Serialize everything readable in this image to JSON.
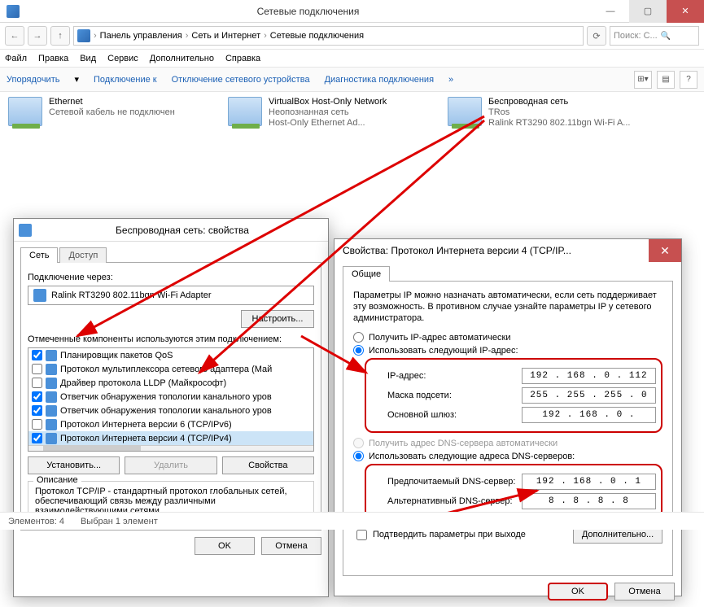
{
  "window": {
    "title": "Сетевые подключения",
    "breadcrumb": [
      "Панель управления",
      "Сеть и Интернет",
      "Сетевые подключения"
    ],
    "search_placeholder": "Поиск: С..."
  },
  "menu": [
    "Файл",
    "Правка",
    "Вид",
    "Сервис",
    "Дополнительно",
    "Справка"
  ],
  "toolbar": {
    "organize": "Упорядочить",
    "connect": "Подключение к",
    "disable": "Отключение сетевого устройства",
    "diag": "Диагностика подключения"
  },
  "netitems": [
    {
      "name": "Ethernet",
      "l2": "Сетевой кабель не подключен",
      "l3": ""
    },
    {
      "name": "VirtualBox Host-Only Network",
      "l2": "Неопознанная сеть",
      "l3": "Host-Only Ethernet Ad..."
    },
    {
      "name": "Беспроводная сеть",
      "l2": "TRos",
      "l3": "Ralink RT3290 802.11bgn Wi-Fi A..."
    }
  ],
  "status": {
    "elements": "Элементов: 4",
    "selected": "Выбран 1 элемент"
  },
  "dlg1": {
    "title": "Беспроводная сеть: свойства",
    "tabs": [
      "Сеть",
      "Доступ"
    ],
    "conn_via": "Подключение через:",
    "adapter": "Ralink RT3290 802.11bgn Wi-Fi Adapter",
    "configure": "Настроить...",
    "components_label": "Отмеченные компоненты используются этим подключением:",
    "components": [
      {
        "checked": true,
        "label": "Планировщик пакетов QoS"
      },
      {
        "checked": false,
        "label": "Протокол мультиплексора сетевого адаптера (Май"
      },
      {
        "checked": false,
        "label": "Драйвер протокола LLDP (Майкрософт)"
      },
      {
        "checked": true,
        "label": "Ответчик обнаружения топологии канального уров"
      },
      {
        "checked": true,
        "label": "Ответчик обнаружения топологии канального уров"
      },
      {
        "checked": false,
        "label": "Протокол Интернета версии 6 (TCP/IPv6)"
      },
      {
        "checked": true,
        "label": "Протокол Интернета версии 4 (TCP/IPv4)"
      }
    ],
    "install": "Установить...",
    "remove": "Удалить",
    "props": "Свойства",
    "desc_legend": "Описание",
    "desc": "Протокол TCP/IP - стандартный протокол глобальных сетей, обеспечивающий связь между различными взаимодействующими сетями.",
    "ok": "OK",
    "cancel": "Отмена"
  },
  "dlg2": {
    "title": "Свойства: Протокол Интернета версии 4 (TCP/IP...",
    "tab": "Общие",
    "info": "Параметры IP можно назначать автоматически, если сеть поддерживает эту возможность. В противном случае узнайте параметры IP у сетевого администратора.",
    "r_auto_ip": "Получить IP-адрес автоматически",
    "r_man_ip": "Использовать следующий IP-адрес:",
    "ip_label": "IP-адрес:",
    "ip": "192 . 168 .   0 . 112",
    "mask_label": "Маска подсети:",
    "mask": "255 . 255 . 255 .   0",
    "gw_label": "Основной шлюз:",
    "gw": "192 . 168 .   0 .    ",
    "r_auto_dns": "Получить адрес DNS-сервера автоматически",
    "r_man_dns": "Использовать следующие адреса DNS-серверов:",
    "dns1_label": "Предпочитаемый DNS-сервер:",
    "dns1": "192 . 168 .   0 .   1",
    "dns2_label": "Альтернативный DNS-сервер:",
    "dns2": "  8 .   8 .   8 .   8",
    "confirm": "Подтвердить параметры при выходе",
    "advanced": "Дополнительно...",
    "ok": "OK",
    "cancel": "Отмена"
  }
}
